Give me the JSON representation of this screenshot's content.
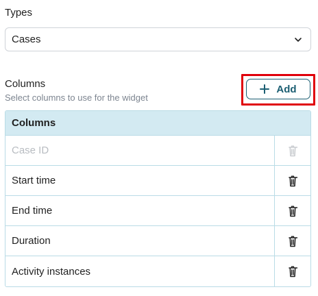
{
  "types": {
    "label": "Types",
    "selected": "Cases",
    "chevron_icon": "chevron-down-icon"
  },
  "columns_section": {
    "heading": "Columns",
    "subtitle": "Select columns to use for the widget",
    "add_label": "Add",
    "add_icon": "plus-icon",
    "highlight_color": "#e0000a",
    "accent_color": "#1b5e72"
  },
  "table": {
    "header": "Columns",
    "header_bg": "#d3eaf2",
    "delete_icon": "trash-icon",
    "rows": [
      {
        "label": "Case ID",
        "disabled": true
      },
      {
        "label": "Start time",
        "disabled": false
      },
      {
        "label": "End time",
        "disabled": false
      },
      {
        "label": "Duration",
        "disabled": false
      },
      {
        "label": "Activity instances",
        "disabled": false
      }
    ]
  }
}
